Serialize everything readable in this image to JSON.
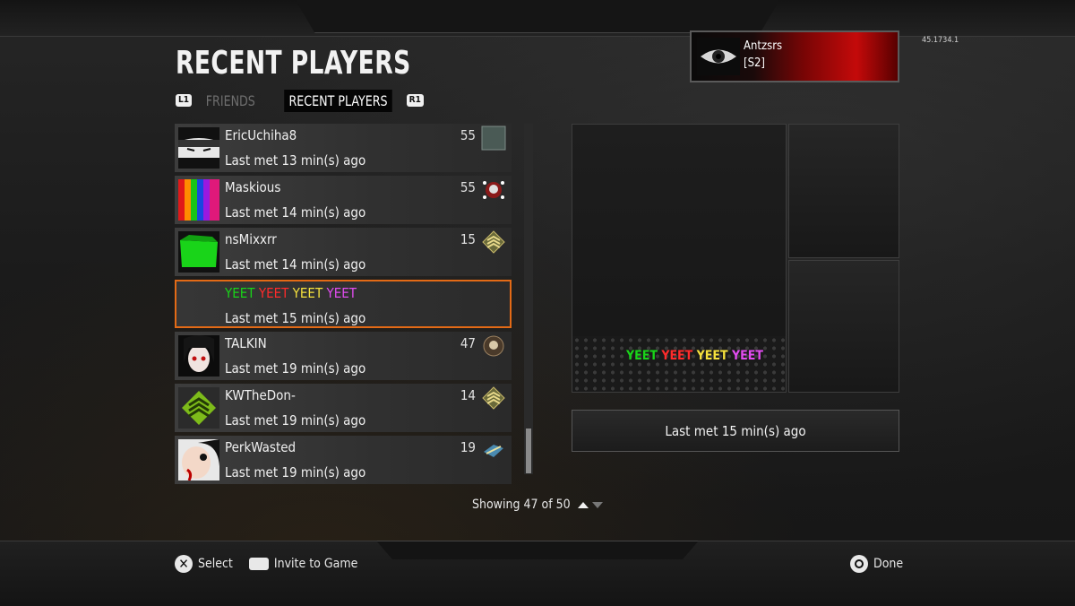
{
  "title": "RECENT PLAYERS",
  "tabs": {
    "left_button": "L1",
    "right_button": "R1",
    "items": [
      {
        "label": "FRIENDS",
        "active": false
      },
      {
        "label": "RECENT PLAYERS",
        "active": true
      }
    ]
  },
  "profile": {
    "name": "Antzsrs",
    "clan": "[S2]"
  },
  "version": "45.1734.1",
  "players": [
    {
      "name": "EricUchiha8",
      "level": "55",
      "met": "Last met 13 min(s) ago",
      "avatar_icon": "anime-ninja-avatar",
      "rank_icon": "prestige-square-icon"
    },
    {
      "name": "Maskious",
      "level": "55",
      "met": "Last met 14 min(s) ago",
      "avatar_icon": "rainbow-stripes-avatar",
      "rank_icon": "prestige-skull-emblem-icon"
    },
    {
      "name": "nsMixxrr",
      "level": "15",
      "met": "Last met 14 min(s) ago",
      "avatar_icon": "green-shape-avatar",
      "rank_icon": "sergeant-chevron-icon"
    },
    {
      "name_parts": [
        "YEET",
        "YEET",
        "YEET",
        "YEET"
      ],
      "met": "Last met 15 min(s) ago",
      "selected": true
    },
    {
      "name": "TALKIN",
      "level": "47",
      "met": "Last met 19 min(s) ago",
      "avatar_icon": "anime-girl-avatar",
      "rank_icon": "rank-emblem-icon"
    },
    {
      "name": "KWTheDon-",
      "level": "14",
      "met": "Last met 19 min(s) ago",
      "avatar_icon": "green-rank-avatar",
      "rank_icon": "sergeant-chevron-icon"
    },
    {
      "name": "PerkWasted",
      "level": "19",
      "met": "Last met 19 min(s) ago",
      "avatar_icon": "bloody-face-avatar",
      "rank_icon": "winged-rank-icon"
    }
  ],
  "showing": "Showing 47 of 50",
  "detail": {
    "name_parts": [
      "YEET",
      "YEET",
      "YEET",
      "YEET"
    ],
    "met": "Last met 15 min(s) ago"
  },
  "footer": {
    "select": "Select",
    "invite": "Invite to Game",
    "done": "Done"
  },
  "colors": {
    "selection_border": "#e36a16",
    "yeet_green": "#19d419",
    "yeet_red": "#ff2b2b",
    "yeet_yellow": "#f6e23d",
    "yeet_pink": "#e24cf0"
  }
}
